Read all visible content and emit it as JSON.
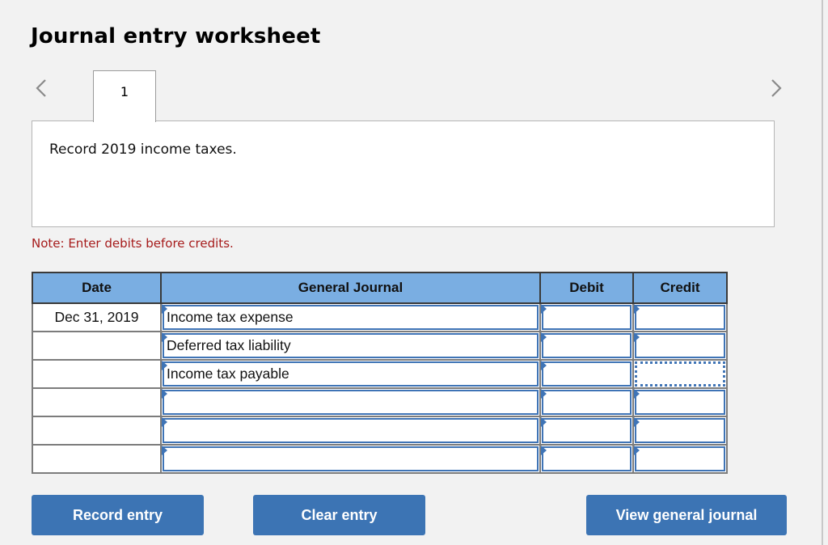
{
  "title": "Journal entry worksheet",
  "navigation": {
    "prev_icon": "chevron-left-icon",
    "next_icon": "chevron-right-icon",
    "tabs": [
      {
        "label": "1",
        "active": true
      }
    ]
  },
  "prompt": "Record 2019 income taxes.",
  "note": "Note: Enter debits before credits.",
  "colors": {
    "header_bg": "#7aaee2",
    "button_bg": "#3c74b4",
    "note_text": "#a61b1b",
    "input_border": "#3f74b6"
  },
  "journal": {
    "columns": [
      "Date",
      "General Journal",
      "Debit",
      "Credit"
    ],
    "rows": [
      {
        "date": "Dec 31, 2019",
        "account": "Income tax expense",
        "debit": "",
        "credit": ""
      },
      {
        "date": "",
        "account": "Deferred tax liability",
        "debit": "",
        "credit": ""
      },
      {
        "date": "",
        "account": "Income tax payable",
        "debit": "",
        "credit": "",
        "focused": "credit"
      },
      {
        "date": "",
        "account": "",
        "debit": "",
        "credit": ""
      },
      {
        "date": "",
        "account": "",
        "debit": "",
        "credit": ""
      },
      {
        "date": "",
        "account": "",
        "debit": "",
        "credit": ""
      }
    ]
  },
  "buttons": {
    "record": "Record entry",
    "clear": "Clear entry",
    "view": "View general journal"
  }
}
